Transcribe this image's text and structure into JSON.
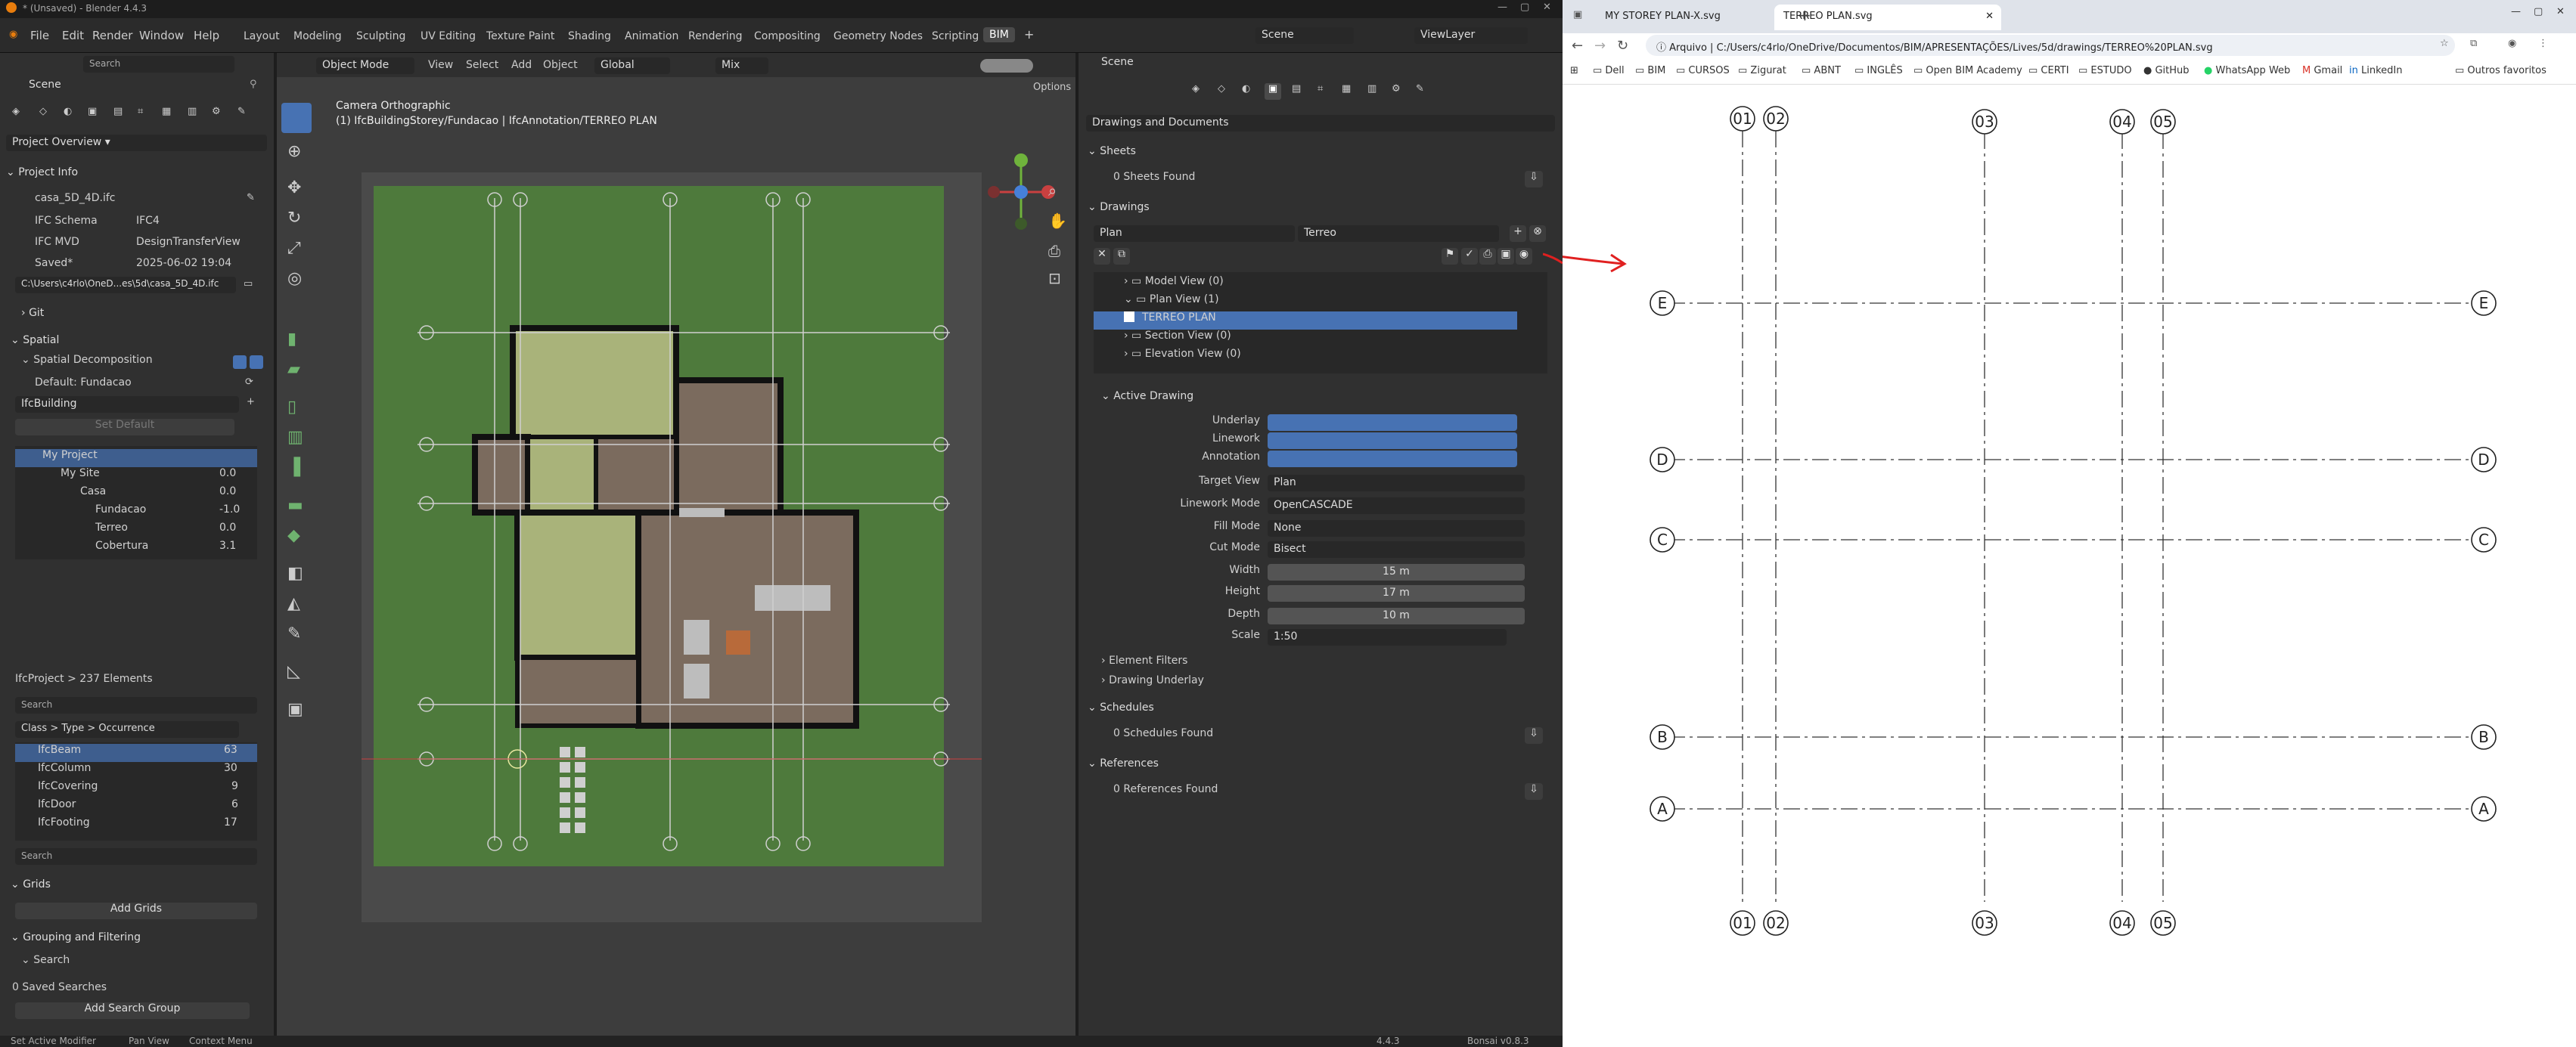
{
  "window": {
    "title": "* (Unsaved) - Blender 4.4.3"
  },
  "menu": [
    "File",
    "Edit",
    "Render",
    "Window",
    "Help"
  ],
  "workspaces": [
    "Layout",
    "Modeling",
    "Sculpting",
    "UV Editing",
    "Texture Paint",
    "Shading",
    "Animation",
    "Rendering",
    "Compositing",
    "Geometry Nodes",
    "Scripting",
    "BIM"
  ],
  "topbar": {
    "scene": "Scene",
    "view_layer": "ViewLayer"
  },
  "left": {
    "search_placeholder": "Search",
    "scene_label": "Scene",
    "project_overview": "Project Overview",
    "project_info": "Project Info",
    "file": "casa_5D_4D.ifc",
    "ifc_schema_label": "IFC Schema",
    "ifc_schema": "IFC4",
    "ifc_mvd_label": "IFC MVD",
    "ifc_mvd": "DesignTransferView",
    "saved_label": "Saved*",
    "saved": "2025-06-02 19:04",
    "path": "C:\\Users\\c4rlo\\OneD...es\\5d\\casa_5D_4D.ifc",
    "git": "Git",
    "spatial": "Spatial",
    "spatial_decomp": "Spatial Decomposition",
    "default": "Default: Fundacao",
    "ifcbuilding": "IfcBuilding",
    "set_default": "Set Default",
    "tree": [
      {
        "name": "My Project",
        "val": ""
      },
      {
        "name": "My Site",
        "val": "0.0"
      },
      {
        "name": "Casa",
        "val": "0.0"
      },
      {
        "name": "Fundacao",
        "val": "-1.0"
      },
      {
        "name": "Terreo",
        "val": "0.0"
      },
      {
        "name": "Cobertura",
        "val": "3.1"
      }
    ],
    "ifc_elements": "IfcProject > 237 Elements",
    "class_type": "Class > Type > Occurrence",
    "classes": [
      {
        "name": "IfcBeam",
        "count": "63"
      },
      {
        "name": "IfcColumn",
        "count": "30"
      },
      {
        "name": "IfcCovering",
        "count": "9"
      },
      {
        "name": "IfcDoor",
        "count": "6"
      },
      {
        "name": "IfcFooting",
        "count": "17"
      }
    ],
    "grids": "Grids",
    "add_grids": "Add Grids",
    "grouping": "Grouping and Filtering",
    "search": "Search",
    "saved_searches": "0 Saved Searches",
    "add_search_group": "Add Search Group"
  },
  "viewport": {
    "mode": "Object Mode",
    "view": "View",
    "select": "Select",
    "add": "Add",
    "object": "Object",
    "orientation": "Global",
    "mix": "Mix",
    "options": "Options",
    "camera": "Camera Orthographic",
    "collection": "(1) IfcBuildingStorey/Fundacao | IfcAnnotation/TERREO PLAN"
  },
  "props": {
    "scene": "Scene",
    "drawings_docs": "Drawings and Documents",
    "sheets": "Sheets",
    "sheets_found": "0 Sheets Found",
    "drawings": "Drawings",
    "plan": "Plan",
    "terreo": "Terreo",
    "views": [
      {
        "name": "Model View (0)"
      },
      {
        "name": "Plan View (1)"
      },
      {
        "name": "TERREO PLAN"
      },
      {
        "name": "Section View (0)"
      },
      {
        "name": "Elevation View (0)"
      }
    ],
    "active_drawing": "Active Drawing",
    "settings": [
      {
        "label": "Underlay",
        "value": ""
      },
      {
        "label": "Linework",
        "value": ""
      },
      {
        "label": "Annotation",
        "value": ""
      },
      {
        "label": "Target View",
        "value": "Plan"
      },
      {
        "label": "Linework Mode",
        "value": "OpenCASCADE"
      },
      {
        "label": "Fill Mode",
        "value": "None"
      },
      {
        "label": "Cut Mode",
        "value": "Bisect"
      },
      {
        "label": "Width",
        "value": "15 m"
      },
      {
        "label": "Height",
        "value": "17 m"
      },
      {
        "label": "Depth",
        "value": "10 m"
      },
      {
        "label": "Scale",
        "value": "1:50"
      }
    ],
    "element_filters": "Element Filters",
    "drawing_underlay": "Drawing Underlay",
    "schedules": "Schedules",
    "schedules_found": "0 Schedules Found",
    "references": "References",
    "references_found": "0 References Found"
  },
  "status": {
    "left1": "Set Active Modifier",
    "left2": "Pan View",
    "left3": "Context Menu",
    "version": "4.4.3",
    "bonsai": "Bonsai v0.8.3"
  },
  "browser": {
    "tabs": [
      "MY STOREY PLAN-X.svg",
      "TERREO PLAN.svg"
    ],
    "url_prefix": "Arquivo",
    "url": "C:/Users/c4rlo/OneDrive/Documentos/BIM/APRESENTAÇÕES/Lives/5d/drawings/TERREO%20PLAN.svg",
    "bookmarks": [
      "Dell",
      "BIM",
      "CURSOS",
      "Zigurat",
      "ABNT",
      "INGLÊS",
      "Open BIM Academy",
      "CERTI",
      "ESTUDO",
      "GitHub",
      "WhatsApp Web",
      "Gmail",
      "LinkedIn"
    ],
    "other_bookmarks": "Outros favoritos"
  },
  "grid_drawing": {
    "columns": [
      "01",
      "02",
      "03",
      "04",
      "05"
    ],
    "rows": [
      "E",
      "D",
      "C",
      "B",
      "A"
    ]
  }
}
